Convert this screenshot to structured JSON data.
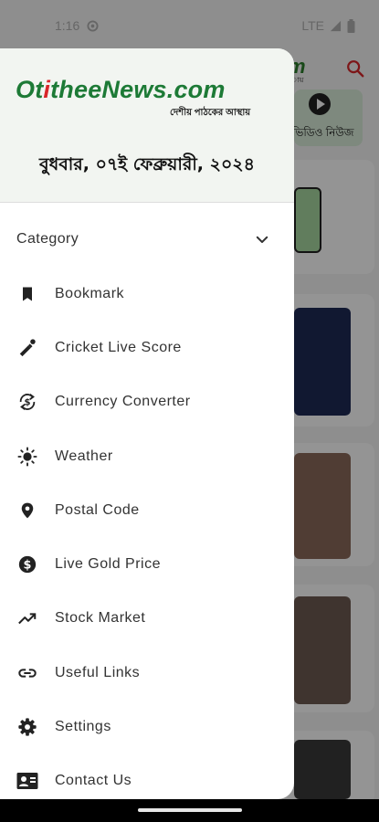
{
  "status_bar": {
    "time": "1:16",
    "network": "LTE"
  },
  "background": {
    "logo_fragment": "m",
    "tagline_fragment": "ায়",
    "video_label": "ভিডিও নিউজ"
  },
  "drawer": {
    "brand": {
      "part1": "Ot",
      "part2": "i",
      "part3": "theeNews.com"
    },
    "tagline": "দেশীয় পাঠকের আস্থায়",
    "date": "বুধবার, ০৭ই ফেব্রুয়ারী, ২০২৪",
    "category_label": "Category",
    "items": [
      {
        "label": "Bookmark",
        "icon": "bookmark-icon"
      },
      {
        "label": "Cricket Live Score",
        "icon": "cricket-icon"
      },
      {
        "label": "Currency Converter",
        "icon": "currency-exchange-icon"
      },
      {
        "label": "Weather",
        "icon": "sun-icon"
      },
      {
        "label": "Postal Code",
        "icon": "location-pin-icon"
      },
      {
        "label": "Live Gold Price",
        "icon": "dollar-circle-icon"
      },
      {
        "label": "Stock Market",
        "icon": "trending-up-icon"
      },
      {
        "label": "Useful Links",
        "icon": "link-icon"
      },
      {
        "label": "Settings",
        "icon": "gear-icon"
      },
      {
        "label": "Contact Us",
        "icon": "contact-card-icon"
      }
    ]
  },
  "colors": {
    "brand_green": "#1d7a36",
    "brand_red": "#d8262a",
    "header_bg": "#f2f5f1"
  }
}
